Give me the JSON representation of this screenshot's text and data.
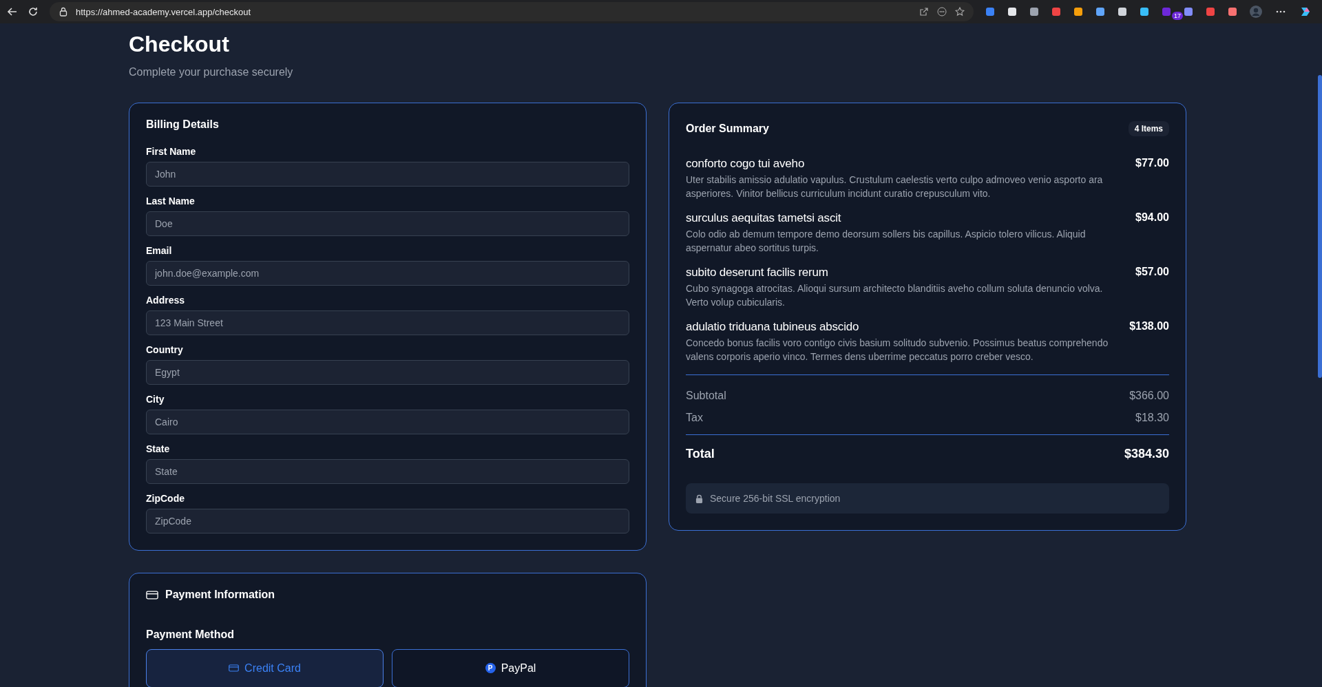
{
  "browser": {
    "url": "https://ahmed-academy.vercel.app/checkout",
    "extension_count": "17"
  },
  "header": {
    "title": "Checkout",
    "subtitle": "Complete your purchase securely"
  },
  "billing": {
    "title": "Billing Details",
    "fields": [
      {
        "label": "First Name",
        "placeholder": "John"
      },
      {
        "label": "Last Name",
        "placeholder": "Doe"
      },
      {
        "label": "Email",
        "placeholder": "john.doe@example.com"
      },
      {
        "label": "Address",
        "placeholder": "123 Main Street"
      },
      {
        "label": "Country",
        "placeholder": "Egypt"
      },
      {
        "label": "City",
        "placeholder": "Cairo"
      },
      {
        "label": "State",
        "placeholder": "State"
      },
      {
        "label": "ZipCode",
        "placeholder": "ZipCode"
      }
    ]
  },
  "payment": {
    "title": "Payment Information",
    "method_label": "Payment Method",
    "methods": [
      {
        "kind": "card",
        "label": "Credit Card",
        "selected": true
      },
      {
        "kind": "paypal",
        "label": "PayPal",
        "badge": "P",
        "selected": false
      }
    ]
  },
  "summary": {
    "title": "Order Summary",
    "count": "4 Items",
    "items": [
      {
        "name": "conforto cogo tui aveho",
        "price": "$77.00",
        "description": "Uter stabilis amissio adulatio vapulus. Crustulum caelestis verto culpo admoveo venio asporto ara asperiores. Vinitor bellicus curriculum incidunt curatio crepusculum vito."
      },
      {
        "name": "surculus aequitas tametsi ascit",
        "price": "$94.00",
        "description": "Colo odio ab demum tempore demo deorsum sollers bis capillus. Aspicio tolero vilicus. Aliquid aspernatur abeo sortitus turpis."
      },
      {
        "name": "subito deserunt facilis rerum",
        "price": "$57.00",
        "description": "Cubo synagoga atrocitas. Alioqui sursum architecto blanditiis aveho collum soluta denuncio volva. Verto volup cubicularis."
      },
      {
        "name": "adulatio triduana tubineus abscido",
        "price": "$138.00",
        "description": "Concedo bonus facilis voro contigo civis basium solitudo subvenio. Possimus beatus comprehendo valens corporis aperio vinco. Termes dens uberrime peccatus porro creber vesco."
      }
    ],
    "subtotal": {
      "label": "Subtotal",
      "value": "$366.00"
    },
    "tax": {
      "label": "Tax",
      "value": "$18.30"
    },
    "total": {
      "label": "Total",
      "value": "$384.30"
    },
    "secure_note": "Secure 256-bit SSL encryption"
  }
}
